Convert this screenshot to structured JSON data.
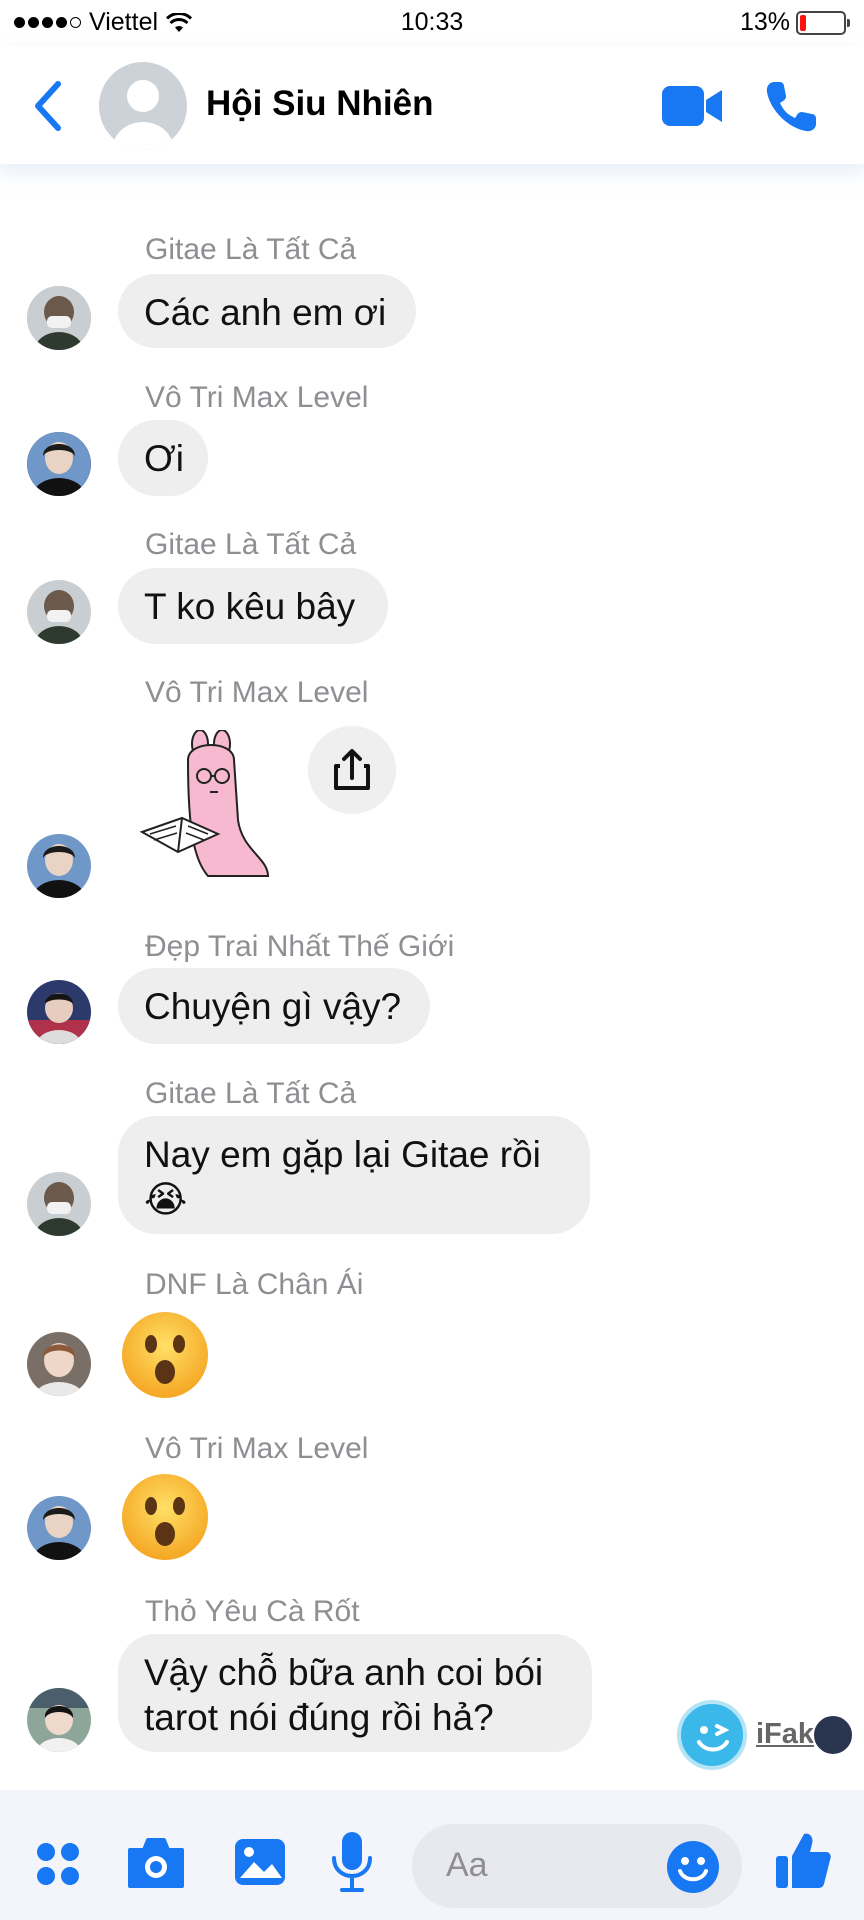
{
  "status_bar": {
    "carrier": "Viettel",
    "time": "10:33",
    "battery": "13%"
  },
  "header": {
    "title": "Hội Siu Nhiên"
  },
  "messages": [
    {
      "sender": "Gitae Là Tất Cả",
      "text": "Các anh em ơi"
    },
    {
      "sender": "Vô Tri Max Level",
      "text": "Ơi"
    },
    {
      "sender": "Gitae Là Tất Cả",
      "text": "T ko kêu bây"
    },
    {
      "sender": "Vô Tri Max Level",
      "type": "sticker"
    },
    {
      "sender": "Đẹp Trai Nhất Thế Giới",
      "text": "Chuyện gì vậy?"
    },
    {
      "sender": "Gitae Là Tất Cả",
      "text_line1": "Nay em gặp lại Gitae rồi",
      "text_line2": "😭"
    },
    {
      "sender": "DNF Là Chân Ái",
      "type": "emoji",
      "emoji": "surprised-face"
    },
    {
      "sender": "Vô Tri Max Level",
      "type": "emoji",
      "emoji": "surprised-face"
    },
    {
      "sender": "Thỏ Yêu Cà Rốt",
      "text_line1": "Vậy chỗ bữa anh coi bói",
      "text_line2": "tarot nói đúng rồi hả?"
    }
  ],
  "watermark": {
    "text": "iFak"
  },
  "composer": {
    "placeholder": "Aa"
  },
  "colors": {
    "accent": "#1877f2",
    "bubble": "#eeeeee",
    "sender": "#8e8e93"
  }
}
